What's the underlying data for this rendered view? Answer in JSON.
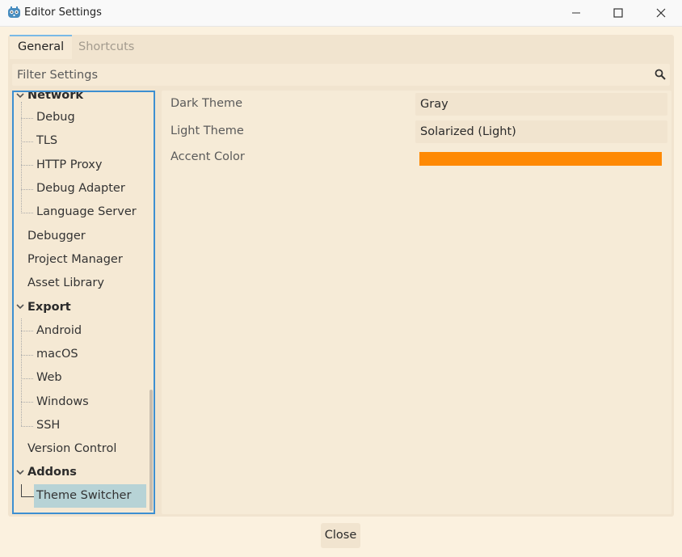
{
  "window": {
    "title": "Editor Settings",
    "icon": "godot-icon",
    "controls": [
      "minimize-icon",
      "maximize-icon",
      "close-icon"
    ]
  },
  "tabs": [
    {
      "label": "General",
      "active": true
    },
    {
      "label": "Shortcuts",
      "active": false
    }
  ],
  "filter": {
    "placeholder": "Filter Settings",
    "value": ""
  },
  "tree": {
    "items": [
      {
        "label": "Network",
        "type": "section",
        "expanded": true
      },
      {
        "label": "Debug",
        "type": "child"
      },
      {
        "label": "TLS",
        "type": "child"
      },
      {
        "label": "HTTP Proxy",
        "type": "child"
      },
      {
        "label": "Debug Adapter",
        "type": "child"
      },
      {
        "label": "Language Server",
        "type": "child"
      },
      {
        "label": "Debugger",
        "type": "item"
      },
      {
        "label": "Project Manager",
        "type": "item"
      },
      {
        "label": "Asset Library",
        "type": "item"
      },
      {
        "label": "Export",
        "type": "section",
        "expanded": true
      },
      {
        "label": "Android",
        "type": "child"
      },
      {
        "label": "macOS",
        "type": "child"
      },
      {
        "label": "Web",
        "type": "child"
      },
      {
        "label": "Windows",
        "type": "child"
      },
      {
        "label": "SSH",
        "type": "child"
      },
      {
        "label": "Version Control",
        "type": "item"
      },
      {
        "label": "Addons",
        "type": "section",
        "expanded": true
      },
      {
        "label": "Theme Switcher",
        "type": "child",
        "selected": true
      }
    ]
  },
  "properties": [
    {
      "label": "Dark Theme",
      "value": "Gray"
    },
    {
      "label": "Light Theme",
      "value": "Solarized (Light)"
    },
    {
      "label": "Accent Color",
      "value_color": "#fe8904"
    }
  ],
  "footer": {
    "close_label": "Close"
  },
  "colors": {
    "background": "#fbf1df",
    "panel": "#f1e4cf",
    "focus_border": "#3d8fd1",
    "selection": "#b7d3d6",
    "accent": "#fe8904"
  }
}
